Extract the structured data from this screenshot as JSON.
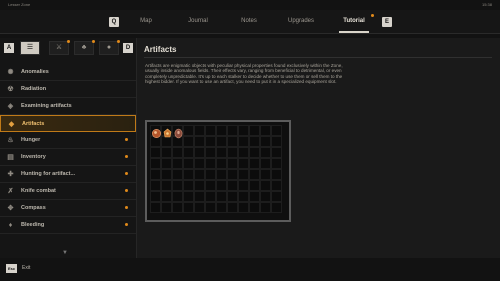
{
  "status": {
    "zone": "Lesser Zone",
    "clock": "15:38"
  },
  "nav": {
    "key_left": "Q",
    "key_right": "E",
    "tabs": [
      {
        "label": "Map"
      },
      {
        "label": "Journal"
      },
      {
        "label": "Notes"
      },
      {
        "label": "Upgrades"
      },
      {
        "label": "Tutorial"
      }
    ],
    "active_tab": "Tutorial"
  },
  "sidebar": {
    "filter_key_left": "A",
    "filter_key_right": "D",
    "filters": [
      {
        "icon": "list-icon",
        "glyph": "☰",
        "active": true
      },
      {
        "icon": "weapon-icon",
        "glyph": "⚔",
        "active": false
      },
      {
        "icon": "nature-icon",
        "glyph": "♣",
        "active": false
      },
      {
        "icon": "grenade-icon",
        "glyph": "●",
        "active": false
      }
    ],
    "items": [
      {
        "label": "Anomalies",
        "icon": "anomaly-icon",
        "glyph": "✺",
        "new": false
      },
      {
        "label": "Radiation",
        "icon": "radiation-icon",
        "glyph": "☢",
        "new": false
      },
      {
        "label": "Examining artifacts",
        "icon": "examine-icon",
        "glyph": "◈",
        "new": false
      },
      {
        "label": "Artifacts",
        "icon": "artifact-icon",
        "glyph": "◆",
        "new": false,
        "active": true
      },
      {
        "label": "Hunger",
        "icon": "hunger-icon",
        "glyph": "♨",
        "new": true
      },
      {
        "label": "Inventory",
        "icon": "inventory-icon",
        "glyph": "▤",
        "new": true
      },
      {
        "label": "Hunting for artifact...",
        "icon": "hunting-icon",
        "glyph": "✚",
        "new": true
      },
      {
        "label": "Knife combat",
        "icon": "knife-icon",
        "glyph": "✗",
        "new": true
      },
      {
        "label": "Compass",
        "icon": "compass-icon",
        "glyph": "✥",
        "new": true
      },
      {
        "label": "Bleeding",
        "icon": "bleeding-icon",
        "glyph": "♦",
        "new": true
      }
    ]
  },
  "content": {
    "title": "Artifacts",
    "description": "Artifacts are enigmatic objects with peculiar physical properties found exclusively within the Zone, usually inside anomalous fields. Their effects vary, ranging from beneficial to detrimental, or even completely unpredictable. It's up to each stalker to decide whether to use them or sell them to the highest bidder. If you want to use an artifact, you need to put it in a specialized equipment slot.",
    "artifact_slots": [
      {
        "name": "artifact-1-icon",
        "color": "#b5552a"
      },
      {
        "name": "artifact-2-icon",
        "color": "#c9742f"
      },
      {
        "name": "artifact-3-icon",
        "color": "#8a4a3a"
      }
    ]
  },
  "footer": {
    "esc_key": "Esc",
    "exit_label": "Exit"
  },
  "colors": {
    "accent": "#e08a1a",
    "active_border": "#c07a18"
  }
}
